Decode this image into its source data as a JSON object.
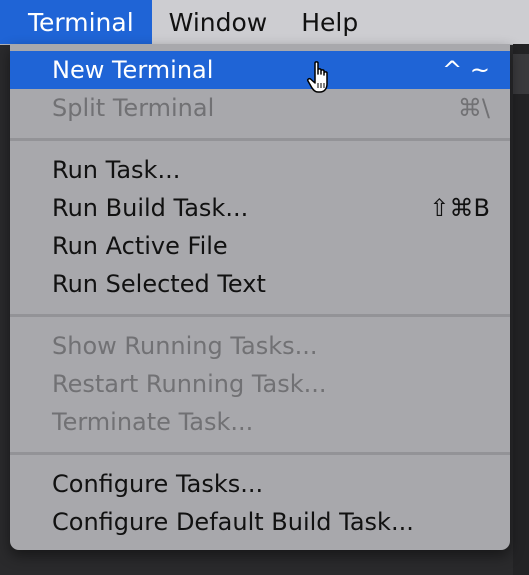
{
  "menubar": {
    "items": [
      {
        "label": "Terminal",
        "active": true
      },
      {
        "label": "Window",
        "active": false
      },
      {
        "label": "Help",
        "active": false
      }
    ]
  },
  "menu": {
    "items": [
      {
        "label": "New Terminal",
        "shortcut": "^ ~",
        "enabled": true,
        "highlighted": true
      },
      {
        "label": "Split Terminal",
        "shortcut": "⌘\\",
        "enabled": false
      },
      {
        "label": "Run Task...",
        "shortcut": "",
        "enabled": true
      },
      {
        "label": "Run Build Task...",
        "shortcut": "⇧⌘B",
        "enabled": true
      },
      {
        "label": "Run Active File",
        "shortcut": "",
        "enabled": true
      },
      {
        "label": "Run Selected Text",
        "shortcut": "",
        "enabled": true
      },
      {
        "label": "Show Running Tasks...",
        "shortcut": "",
        "enabled": false
      },
      {
        "label": "Restart Running Task...",
        "shortcut": "",
        "enabled": false
      },
      {
        "label": "Terminate Task...",
        "shortcut": "",
        "enabled": false
      },
      {
        "label": "Configure Tasks...",
        "shortcut": "",
        "enabled": true
      },
      {
        "label": "Configure Default Build Task...",
        "shortcut": "",
        "enabled": true
      }
    ]
  },
  "cursor": {
    "icon": "pointing-hand-cursor-icon"
  },
  "colors": {
    "highlight": "#1f64d6",
    "menu_background": "#a8a8ac",
    "menubar_background": "#cdcdd1",
    "disabled_text": "#717174"
  }
}
